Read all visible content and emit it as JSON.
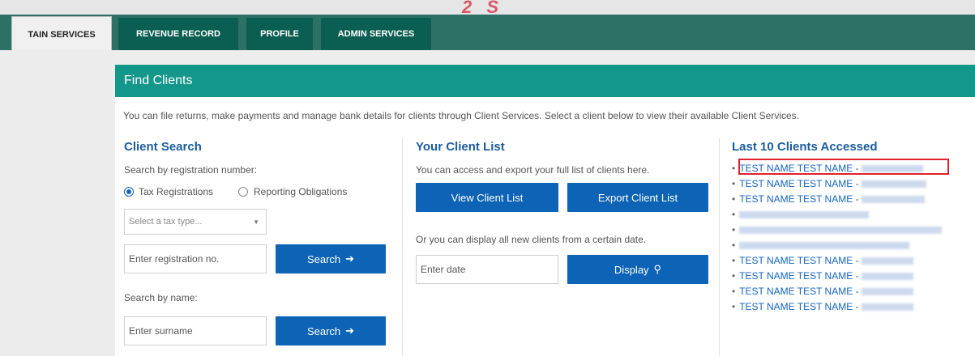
{
  "watermark": "2 S",
  "nav": {
    "tabs": [
      {
        "label": "TAIN SERVICES"
      },
      {
        "label": "REVENUE RECORD"
      },
      {
        "label": "PROFILE"
      },
      {
        "label": "ADMIN SERVICES"
      }
    ]
  },
  "panel": {
    "title": "Find Clients",
    "intro": "You can file returns, make payments and manage bank details for clients through Client Services. Select a client below to view their available Client Services."
  },
  "client_search": {
    "title": "Client Search",
    "by_reg_label": "Search by registration number:",
    "radio_tax": "Tax Registrations",
    "radio_reporting": "Reporting Obligations",
    "tax_type_placeholder": "Select a tax type...",
    "reg_placeholder": "Enter registration no.",
    "search_label": "Search",
    "by_name_label": "Search by name:",
    "surname_placeholder": "Enter surname",
    "search_name_label": "Search"
  },
  "client_list": {
    "title": "Your Client List",
    "desc": "You can access and export your full list of clients here.",
    "view_label": "View Client List",
    "export_label": "Export Client List",
    "date_desc": "Or you can display all new clients from a certain date.",
    "date_placeholder": "Enter date",
    "display_label": "Display"
  },
  "recent": {
    "title": "Last 10 Clients Accessed",
    "items": [
      {
        "name": "TEST NAME TEST NAME -"
      },
      {
        "name": "TEST NAME TEST NAME -"
      },
      {
        "name": "TEST NAME TEST NAME -"
      },
      {
        "name": ""
      },
      {
        "name": ""
      },
      {
        "name": ""
      },
      {
        "name": "TEST NAME TEST NAME -"
      },
      {
        "name": "TEST NAME TEST NAME -"
      },
      {
        "name": "TEST NAME TEST NAME -"
      },
      {
        "name": "TEST NAME TEST NAME -"
      }
    ]
  },
  "colors": {
    "nav": "#2d7066",
    "header": "#12978a",
    "button": "#0d63b5",
    "link": "#1565c0",
    "highlight": "#e2202c"
  }
}
